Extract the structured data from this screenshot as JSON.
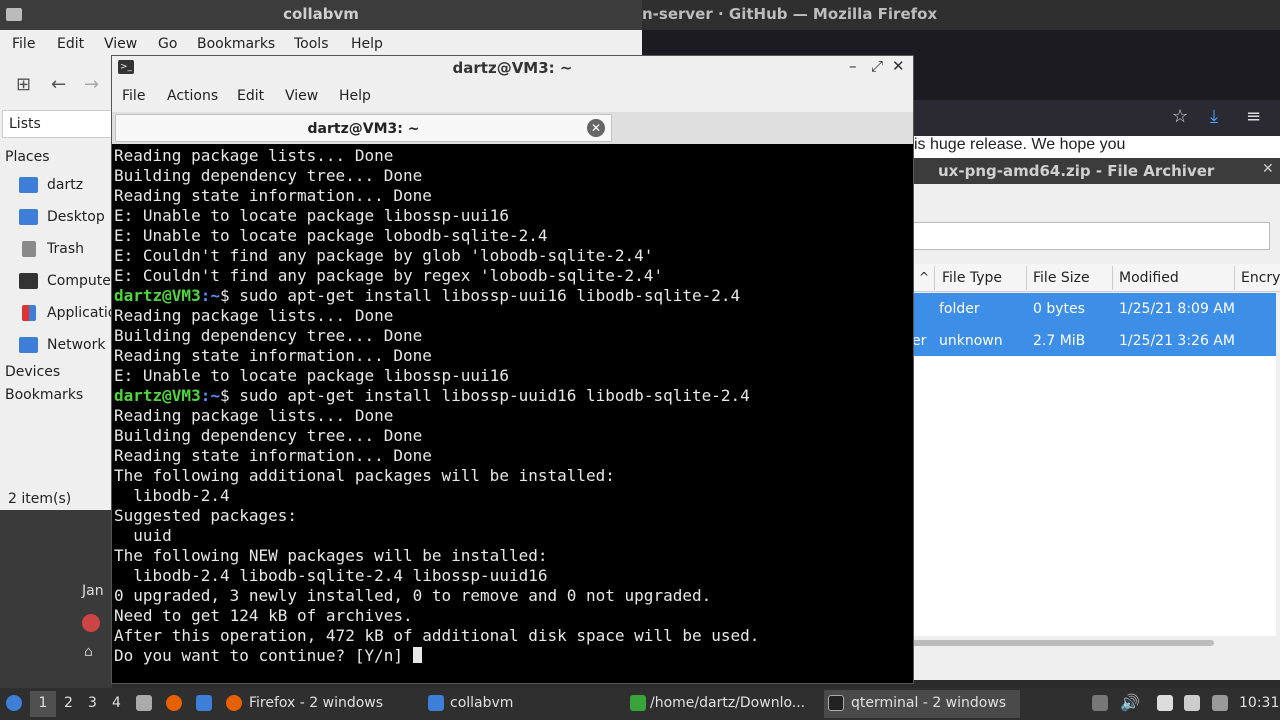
{
  "outer": {
    "title": "collabvm"
  },
  "firefox": {
    "title": "n-server · GitHub — Mozilla Firefox",
    "page_text": "is huge release. We hope you"
  },
  "archiver": {
    "title": "ux-png-amd64.zip - File Archiver",
    "columns": [
      "File Type",
      "File Size",
      "Modified",
      "Encry"
    ],
    "rows": [
      {
        "name": "",
        "type": "folder",
        "size": "0 bytes",
        "modified": "1/25/21 8:09 AM"
      },
      {
        "name": "er",
        "type": "unknown",
        "size": "2.7 MiB",
        "modified": "1/25/21 3:26 AM"
      }
    ]
  },
  "filemanager": {
    "menu": [
      "File",
      "Edit",
      "View",
      "Go",
      "Bookmarks",
      "Tools",
      "Help"
    ],
    "sidepanel_mode": "Lists",
    "places_label": "Places",
    "places": [
      {
        "label": "dartz",
        "icon": "home-folder-icon",
        "color": "#3d7fd6"
      },
      {
        "label": "Desktop",
        "icon": "desktop-folder-icon",
        "color": "#3d7fd6"
      },
      {
        "label": "Trash",
        "icon": "trash-icon",
        "color": "#8a8a8a"
      },
      {
        "label": "Computer",
        "icon": "computer-icon",
        "color": "#333333"
      },
      {
        "label": "Applications",
        "icon": "applications-icon",
        "color": "#3d7fd6"
      },
      {
        "label": "Network",
        "icon": "network-icon",
        "color": "#3d7fd6"
      }
    ],
    "devices_label": "Devices",
    "bookmarks_label": "Bookmarks",
    "status": "2 item(s)"
  },
  "desktop": {
    "partial_label": "Jan"
  },
  "terminal": {
    "title": "dartz@VM3: ~",
    "menu": [
      "File",
      "Actions",
      "Edit",
      "View",
      "Help"
    ],
    "tab_label": "dartz@VM3: ~",
    "lines": [
      {
        "text": "Reading package lists... Done"
      },
      {
        "text": "Building dependency tree... Done"
      },
      {
        "text": "Reading state information... Done"
      },
      {
        "text": "E: Unable to locate package libossp-uui16"
      },
      {
        "text": "E: Unable to locate package lobodb-sqlite-2.4"
      },
      {
        "text": "E: Couldn't find any package by glob 'lobodb-sqlite-2.4'"
      },
      {
        "text": "E: Couldn't find any package by regex 'lobodb-sqlite-2.4'"
      },
      {
        "user": "dartz@VM3",
        "path": ":~",
        "text": "$ sudo apt-get install libossp-uui16 libodb-sqlite-2.4"
      },
      {
        "text": "Reading package lists... Done"
      },
      {
        "text": "Building dependency tree... Done"
      },
      {
        "text": "Reading state information... Done"
      },
      {
        "text": "E: Unable to locate package libossp-uui16"
      },
      {
        "user": "dartz@VM3",
        "path": ":~",
        "text": "$ sudo apt-get install libossp-uuid16 libodb-sqlite-2.4"
      },
      {
        "text": "Reading package lists... Done"
      },
      {
        "text": "Building dependency tree... Done"
      },
      {
        "text": "Reading state information... Done"
      },
      {
        "text": "The following additional packages will be installed:"
      },
      {
        "text": "  libodb-2.4"
      },
      {
        "text": "Suggested packages:"
      },
      {
        "text": "  uuid"
      },
      {
        "text": "The following NEW packages will be installed:"
      },
      {
        "text": "  libodb-2.4 libodb-sqlite-2.4 libossp-uuid16"
      },
      {
        "text": "0 upgraded, 3 newly installed, 0 to remove and 0 not upgraded."
      },
      {
        "text": "Need to get 124 kB of archives."
      },
      {
        "text": "After this operation, 472 kB of additional disk space will be used."
      },
      {
        "text": "Do you want to continue? [Y/n] ",
        "cursor": true
      }
    ]
  },
  "taskbar": {
    "workspaces": [
      "1",
      "2",
      "3",
      "4"
    ],
    "tasks": [
      {
        "label": "Firefox - 2 windows",
        "icon": "firefox-icon"
      },
      {
        "label": "collabvm",
        "icon": "folder-icon"
      },
      {
        "label": "/home/dartz/Downlo...",
        "icon": "archive-icon"
      },
      {
        "label": "qterminal - 2 windows",
        "icon": "terminal-icon"
      }
    ],
    "clock": "10:31"
  }
}
